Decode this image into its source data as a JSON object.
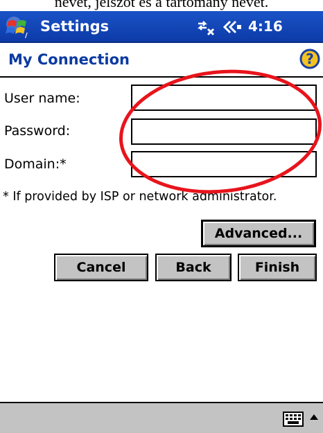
{
  "caption": "nevet, jelszót és a tartomány nevet.",
  "titlebar": {
    "title": "Settings",
    "start_icon": "windows-flag-icon",
    "connectivity_icon": "connectivity-icon",
    "volume_icon": "speaker-icon",
    "time": "4:16"
  },
  "page": {
    "title": "My Connection",
    "help_icon": "help-icon"
  },
  "form": {
    "user_name_label": "User name:",
    "user_name_value": "",
    "password_label": "Password:",
    "password_value": "",
    "domain_label": "Domain:*",
    "domain_value": "",
    "footnote": "* If provided by ISP or network administrator."
  },
  "buttons": {
    "advanced": "Advanced...",
    "cancel": "Cancel",
    "back": "Back",
    "finish": "Finish"
  },
  "annotation": {
    "color": "#e8141c"
  },
  "menubar": {
    "keyboard_icon": "keyboard-icon",
    "sip_arrow_icon": "up-arrow-icon"
  },
  "colors": {
    "titlebar": "#1a53c7",
    "page_title": "#0b3aa2",
    "button_face": "#c3c3c3"
  }
}
